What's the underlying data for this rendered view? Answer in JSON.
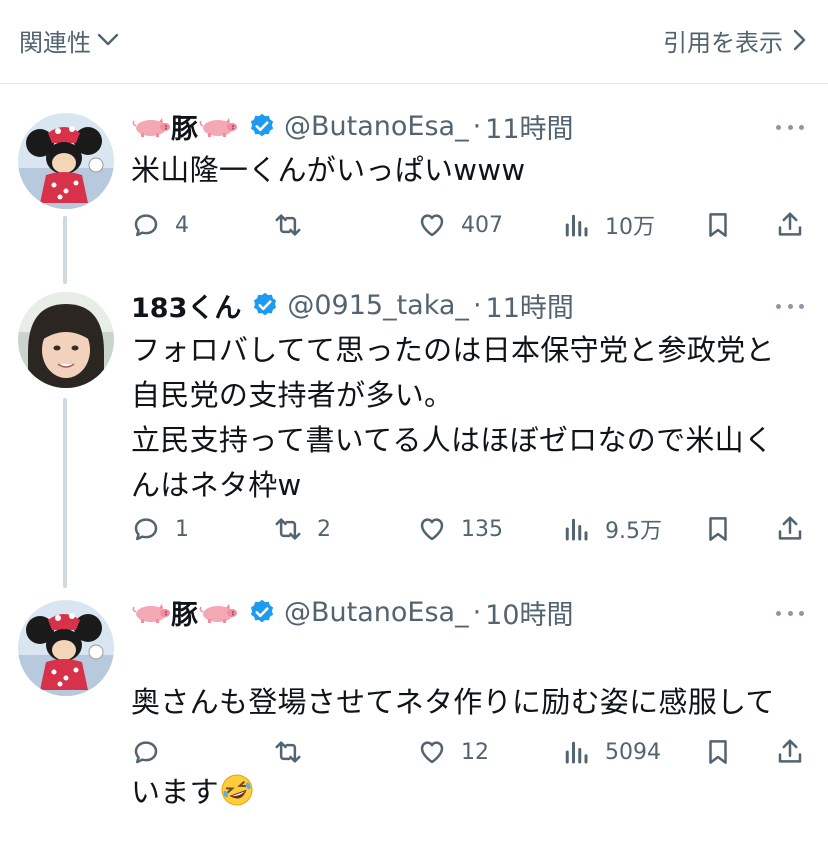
{
  "top_bar": {
    "sort_label": "関連性",
    "quotes_label": "引用を表示"
  },
  "posts": [
    {
      "display_name": "豚",
      "handle": "@ButanoEsa_",
      "separator": "·",
      "time": "11時間",
      "text": "米山隆一くんがいっぱいwww",
      "replies": "4",
      "reposts": "",
      "likes": "407",
      "views": "10万"
    },
    {
      "display_name": "183くん",
      "handle": "@0915_taka_",
      "separator": "·",
      "time": "11時間",
      "text": "フォロバしてて思ったのは日本保守党と参政党と\n自民党の支持者が多い。\n立民支持って書いてる人はほぼゼロなので米山く\nんはネタ枠w",
      "replies": "1",
      "reposts": "2",
      "likes": "135",
      "views": "9.5万"
    },
    {
      "display_name": "豚",
      "handle": "@ButanoEsa_",
      "separator": "·",
      "time": "10時間",
      "text_line1": "奥さんも登場させてネタ作りに励む姿に感服して",
      "text_line2": "います",
      "replies": "",
      "reposts": "",
      "likes": "12",
      "views": "5094"
    }
  ],
  "colors": {
    "verified": "#1d9bf0",
    "secondary_text": "#536471",
    "thread_line": "#cfd9de"
  },
  "icons": [
    "chevron-down-icon",
    "chevron-right-icon",
    "pig-emoji",
    "verified-badge-icon",
    "more-icon",
    "reply-icon",
    "repost-icon",
    "like-icon",
    "views-icon",
    "bookmark-icon",
    "share-icon",
    "rofl-emoji"
  ]
}
